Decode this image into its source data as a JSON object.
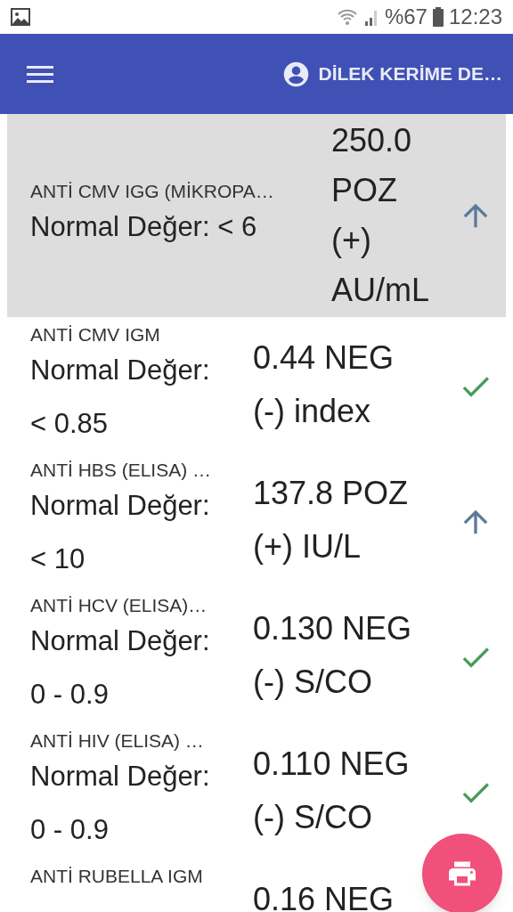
{
  "status_bar": {
    "battery": "%67",
    "time": "12:23"
  },
  "app_bar": {
    "user": "DİLEK KERİME DE…"
  },
  "results": [
    {
      "name": "ANTİ CMV IGG (MİKROPA…",
      "normal_label": "Normal Değer:",
      "normal_value": "< 6",
      "value": "250.0 POZ (+) AU/mL",
      "kind": "high",
      "selected": true
    },
    {
      "name": "ANTİ CMV IGM",
      "normal_label": "Normal Değer:",
      "normal_value": "< 0.85",
      "value": "0.44 NEG (-) index",
      "kind": "normal",
      "selected": false
    },
    {
      "name": "ANTİ HBS (ELISA) …",
      "normal_label": "Normal Değer:",
      "normal_value": "< 10",
      "value": "137.8 POZ (+) IU/L",
      "kind": "high",
      "selected": false
    },
    {
      "name": "ANTİ HCV (ELISA)…",
      "normal_label": "Normal Değer:",
      "normal_value": "0 - 0.9",
      "value": "0.130 NEG (-) S/CO",
      "kind": "normal",
      "selected": false
    },
    {
      "name": "ANTİ HIV (ELISA) …",
      "normal_label": "Normal Değer:",
      "normal_value": "0 - 0.9",
      "value": "0.110 NEG (-) S/CO",
      "kind": "normal",
      "selected": false
    },
    {
      "name": "ANTİ RUBELLA IGM",
      "value": "0.16 NEG",
      "selected": false
    }
  ]
}
